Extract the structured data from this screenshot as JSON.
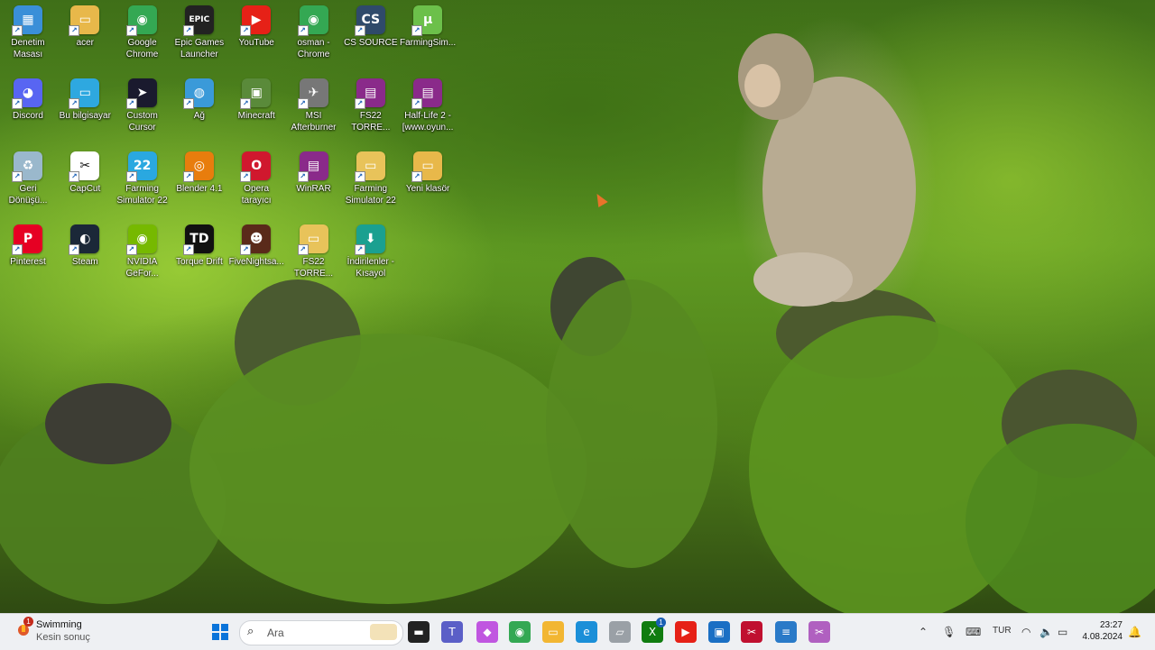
{
  "desktop": {
    "icons": [
      {
        "label": "Denetim\nMasası",
        "icon": "control-panel-icon",
        "color": "#3a8fd8",
        "glyph": "▦"
      },
      {
        "label": "acer",
        "icon": "folder-icon",
        "color": "#e8b84a",
        "glyph": "▭"
      },
      {
        "label": "Google\nChrome",
        "icon": "chrome-icon",
        "color": "#34a853",
        "glyph": "◉"
      },
      {
        "label": "Epic Games\nLauncher",
        "icon": "epic-games-icon",
        "color": "#222222",
        "glyph": "EPIC"
      },
      {
        "label": "YouTube",
        "icon": "youtube-icon",
        "color": "#e62117",
        "glyph": "▶"
      },
      {
        "label": "osman -\nChrome",
        "icon": "chrome-profile-icon",
        "color": "#34a853",
        "glyph": "◉"
      },
      {
        "label": "CS SOURCE",
        "icon": "cs-source-icon",
        "color": "#2f4a6a",
        "glyph": "CS"
      },
      {
        "label": "FarmingSim...",
        "icon": "utorrent-icon",
        "color": "#6cc04a",
        "glyph": "µ"
      },
      {
        "label": "Discord",
        "icon": "discord-icon",
        "color": "#5865f2",
        "glyph": "◕"
      },
      {
        "label": "Bu bilgisayar",
        "icon": "this-pc-icon",
        "color": "#2ea8e0",
        "glyph": "▭"
      },
      {
        "label": "Custom\nCursor",
        "icon": "custom-cursor-icon",
        "color": "#1a1a2e",
        "glyph": "➤"
      },
      {
        "label": "Ağ",
        "icon": "network-icon",
        "color": "#3a9ad9",
        "glyph": "◍"
      },
      {
        "label": "Minecraft",
        "icon": "minecraft-icon",
        "color": "#5a8a3a",
        "glyph": "▣"
      },
      {
        "label": "MSI\nAfterburner",
        "icon": "msi-afterburner-icon",
        "color": "#777777",
        "glyph": "✈"
      },
      {
        "label": "FS22 TORRE...",
        "icon": "winrar-archive-icon",
        "color": "#8a2a8a",
        "glyph": "▤"
      },
      {
        "label": "Half-Life 2 -\n[www.oyun...",
        "icon": "winrar-archive-icon",
        "color": "#8a2a8a",
        "glyph": "▤"
      },
      {
        "label": "Geri\nDönüşü...",
        "icon": "recycle-bin-icon",
        "color": "#9ab8cc",
        "glyph": "♻"
      },
      {
        "label": "CapCut",
        "icon": "capcut-icon",
        "color": "#ffffff",
        "glyph": "✂"
      },
      {
        "label": "Farming\nSimulator 22",
        "icon": "farming-simulator-icon",
        "color": "#2aa8e0",
        "glyph": "22"
      },
      {
        "label": "Blender 4.1",
        "icon": "blender-icon",
        "color": "#e87d0d",
        "glyph": "◎"
      },
      {
        "label": "Opera\ntarayıcı",
        "icon": "opera-icon",
        "color": "#d0182e",
        "glyph": "O"
      },
      {
        "label": "WinRAR",
        "icon": "winrar-icon",
        "color": "#8a2a8a",
        "glyph": "▤"
      },
      {
        "label": "Farming\nSimulator 22",
        "icon": "zip-folder-icon",
        "color": "#e8c35a",
        "glyph": "▭"
      },
      {
        "label": "Yeni klasör",
        "icon": "folder-icon",
        "color": "#e8b84a",
        "glyph": "▭"
      },
      {
        "label": "Pinterest",
        "icon": "pinterest-icon",
        "color": "#e60023",
        "glyph": "P"
      },
      {
        "label": "Steam",
        "icon": "steam-icon",
        "color": "#1b2838",
        "glyph": "◐"
      },
      {
        "label": "NVIDIA\nGeFor...",
        "icon": "nvidia-icon",
        "color": "#76b900",
        "glyph": "◉"
      },
      {
        "label": "Torque Drift",
        "icon": "torque-drift-icon",
        "color": "#111111",
        "glyph": "TD"
      },
      {
        "label": "FiveNightsa...",
        "icon": "fnaf-icon",
        "color": "#5a2a1a",
        "glyph": "☻"
      },
      {
        "label": "FS22 TORRE...",
        "icon": "folder-icon",
        "color": "#e8c35a",
        "glyph": "▭"
      },
      {
        "label": "İndirilenler -\nKısayol",
        "icon": "downloads-shortcut-icon",
        "color": "#1aa090",
        "glyph": "⬇"
      }
    ]
  },
  "taskbar": {
    "weather": {
      "title": "Swimming",
      "subtitle": "Kesin sonuç",
      "badge": "1"
    },
    "search_placeholder": "Ara",
    "apps": [
      {
        "name": "start-button",
        "glyph": "⊞",
        "color": "#0a74da"
      },
      {
        "name": "task-view-button",
        "glyph": "▬",
        "color": "#222222"
      },
      {
        "name": "teams-icon",
        "glyph": "T",
        "color": "#5b5fc7"
      },
      {
        "name": "copilot-icon",
        "glyph": "◆",
        "color": "#c056e0"
      },
      {
        "name": "chrome-taskbar-icon",
        "glyph": "◉",
        "color": "#34a853"
      },
      {
        "name": "file-explorer-icon",
        "glyph": "▭",
        "color": "#f2b632"
      },
      {
        "name": "edge-icon",
        "glyph": "e",
        "color": "#1b8fd8"
      },
      {
        "name": "generic-app-icon",
        "glyph": "▱",
        "color": "#9aa0a6"
      },
      {
        "name": "xbox-icon",
        "glyph": "X",
        "color": "#107c10"
      },
      {
        "name": "youtube-taskbar-icon",
        "glyph": "▶",
        "color": "#e62117"
      },
      {
        "name": "store-icon",
        "glyph": "▣",
        "color": "#1a6fc4"
      },
      {
        "name": "capcut-taskbar-icon",
        "glyph": "✂",
        "color": "#c01030"
      },
      {
        "name": "notepad-icon",
        "glyph": "≡",
        "color": "#2a7ac8"
      },
      {
        "name": "snipping-tool-icon",
        "glyph": "✂",
        "color": "#b060c0"
      }
    ],
    "xbox_badge": "1",
    "tray": {
      "language": "TUR",
      "time": "23:27",
      "date": "4.08.2024"
    }
  }
}
